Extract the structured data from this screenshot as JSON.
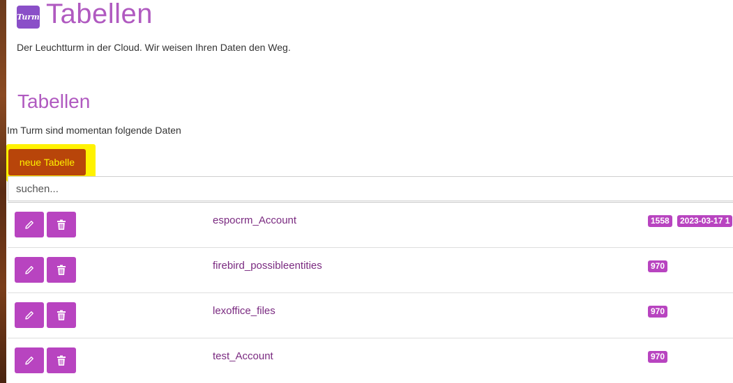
{
  "header": {
    "logo_text": "Turm",
    "title": "Tabellen",
    "tagline": "Der Leuchtturm in der Cloud. Wir weisen Ihren Daten den Weg."
  },
  "section": {
    "title": "Tabellen",
    "description": "Im Turm sind momentan folgende Daten"
  },
  "new_table_button": "neue Tabelle",
  "search": {
    "placeholder": "suchen...",
    "value": ""
  },
  "colors": {
    "accent": "#b844c0",
    "title": "#b05ac0",
    "new_button_bg": "#b8450a",
    "new_button_text": "#fff200",
    "highlight": "#fff200"
  },
  "rows": [
    {
      "name": "espocrm_Account",
      "count": "1558",
      "date": "2023-03-17 1"
    },
    {
      "name": "firebird_possibleentities",
      "count": "970"
    },
    {
      "name": "lexoffice_files",
      "count": "970"
    },
    {
      "name": "test_Account",
      "count": "970"
    }
  ],
  "icons": {
    "edit": "pencil-icon",
    "delete": "trash-icon"
  }
}
